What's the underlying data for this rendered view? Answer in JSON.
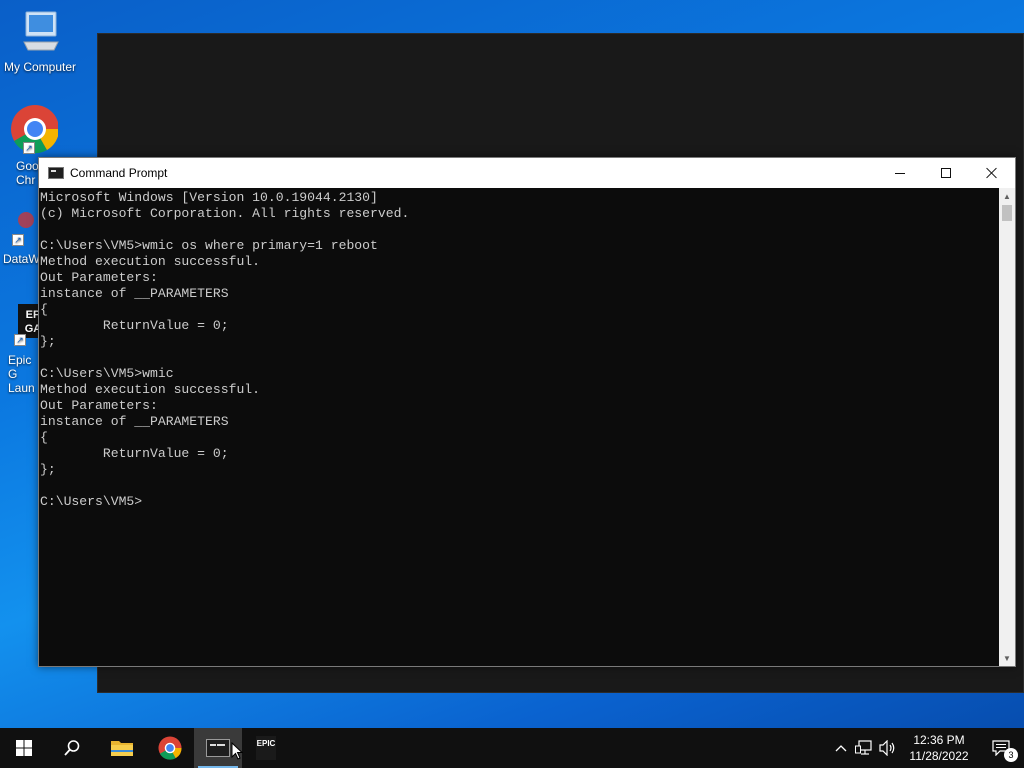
{
  "desktop": {
    "icons": [
      {
        "label": "My Computer",
        "icon": "computer-icon"
      },
      {
        "label": "Goo Chr",
        "icon": "chrome-icon"
      },
      {
        "label": "DataW",
        "icon": "datawrapper-icon"
      },
      {
        "label": "Epic G Laun",
        "icon": "epic-games-icon"
      }
    ]
  },
  "cmd_window": {
    "title": "Command Prompt",
    "console_text": "Microsoft Windows [Version 10.0.19044.2130]\n(c) Microsoft Corporation. All rights reserved.\n\nC:\\Users\\VM5>wmic os where primary=1 reboot\nMethod execution successful.\nOut Parameters:\ninstance of __PARAMETERS\n{\n        ReturnValue = 0;\n};\n\nC:\\Users\\VM5>wmic\nMethod execution successful.\nOut Parameters:\ninstance of __PARAMETERS\n{\n        ReturnValue = 0;\n};\n\nC:\\Users\\VM5>"
  },
  "taskbar": {
    "clock_time": "12:36 PM",
    "clock_date": "11/28/2022",
    "notification_count": "3",
    "epic_label": "EPIC"
  },
  "colors": {
    "console_bg": "#0c0c0c",
    "console_fg": "#cccccc",
    "taskbar_bg": "#101010",
    "accent": "#76b9ed"
  }
}
